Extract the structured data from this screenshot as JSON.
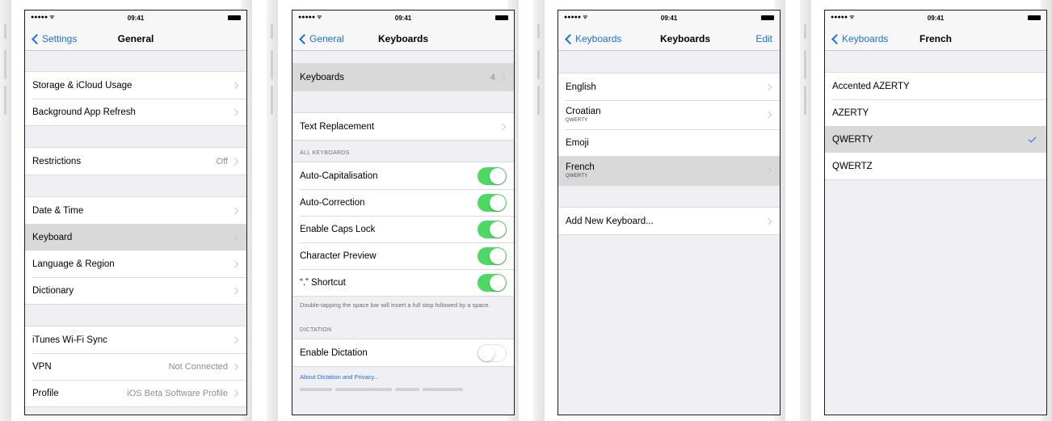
{
  "status_bar": {
    "signal": "●●●●● ᯤ",
    "time": "09:41"
  },
  "screen1": {
    "nav": {
      "back": "Settings",
      "title": "General"
    },
    "rows": {
      "storage": "Storage & iCloud Usage",
      "background_refresh": "Background App Refresh",
      "restrictions": "Restrictions",
      "restrictions_value": "Off",
      "date_time": "Date & Time",
      "keyboard": "Keyboard",
      "language_region": "Language & Region",
      "dictionary": "Dictionary",
      "itunes_wifi_sync": "iTunes Wi-Fi Sync",
      "vpn": "VPN",
      "vpn_value": "Not Connected",
      "profile": "Profile",
      "profile_value": "iOS Beta Software Profile"
    }
  },
  "screen2": {
    "nav": {
      "back": "General",
      "title": "Keyboards"
    },
    "keyboards_row": "Keyboards",
    "keyboards_count": "4",
    "text_replacement": "Text Replacement",
    "all_keyboards_header": "ALL KEYBOARDS",
    "toggles": [
      {
        "label": "Auto-Capitalisation",
        "on": true
      },
      {
        "label": "Auto-Correction",
        "on": true
      },
      {
        "label": "Enable Caps Lock",
        "on": true
      },
      {
        "label": "Character Preview",
        "on": true
      },
      {
        "label": "“.” Shortcut",
        "on": true
      }
    ],
    "shortcut_note": "Double-tapping the space bar will insert a full stop followed by a space.",
    "dictation_header": "DICTATION",
    "enable_dictation": "Enable Dictation",
    "enable_dictation_on": false,
    "about_dictation": "About Dictation and Privacy..."
  },
  "screen3": {
    "nav": {
      "back": "Keyboards",
      "title": "Keyboards",
      "action": "Edit"
    },
    "keyboards": [
      {
        "name": "English",
        "layout": ""
      },
      {
        "name": "Croatian",
        "layout": "QWERTY"
      },
      {
        "name": "Emoji",
        "layout": ""
      },
      {
        "name": "French",
        "layout": "QWERTY"
      }
    ],
    "add_new": "Add New Keyboard..."
  },
  "screen4": {
    "nav": {
      "back": "Keyboards",
      "title": "French"
    },
    "layouts": [
      "Accented AZERTY",
      "AZERTY",
      "QWERTY",
      "QWERTZ"
    ],
    "selected": "QWERTY"
  },
  "colors": {
    "accent": "#1a6ef2",
    "toggle_on": "#4cd964",
    "background": "#efeff4",
    "selected_row": "#d9d9d9"
  }
}
